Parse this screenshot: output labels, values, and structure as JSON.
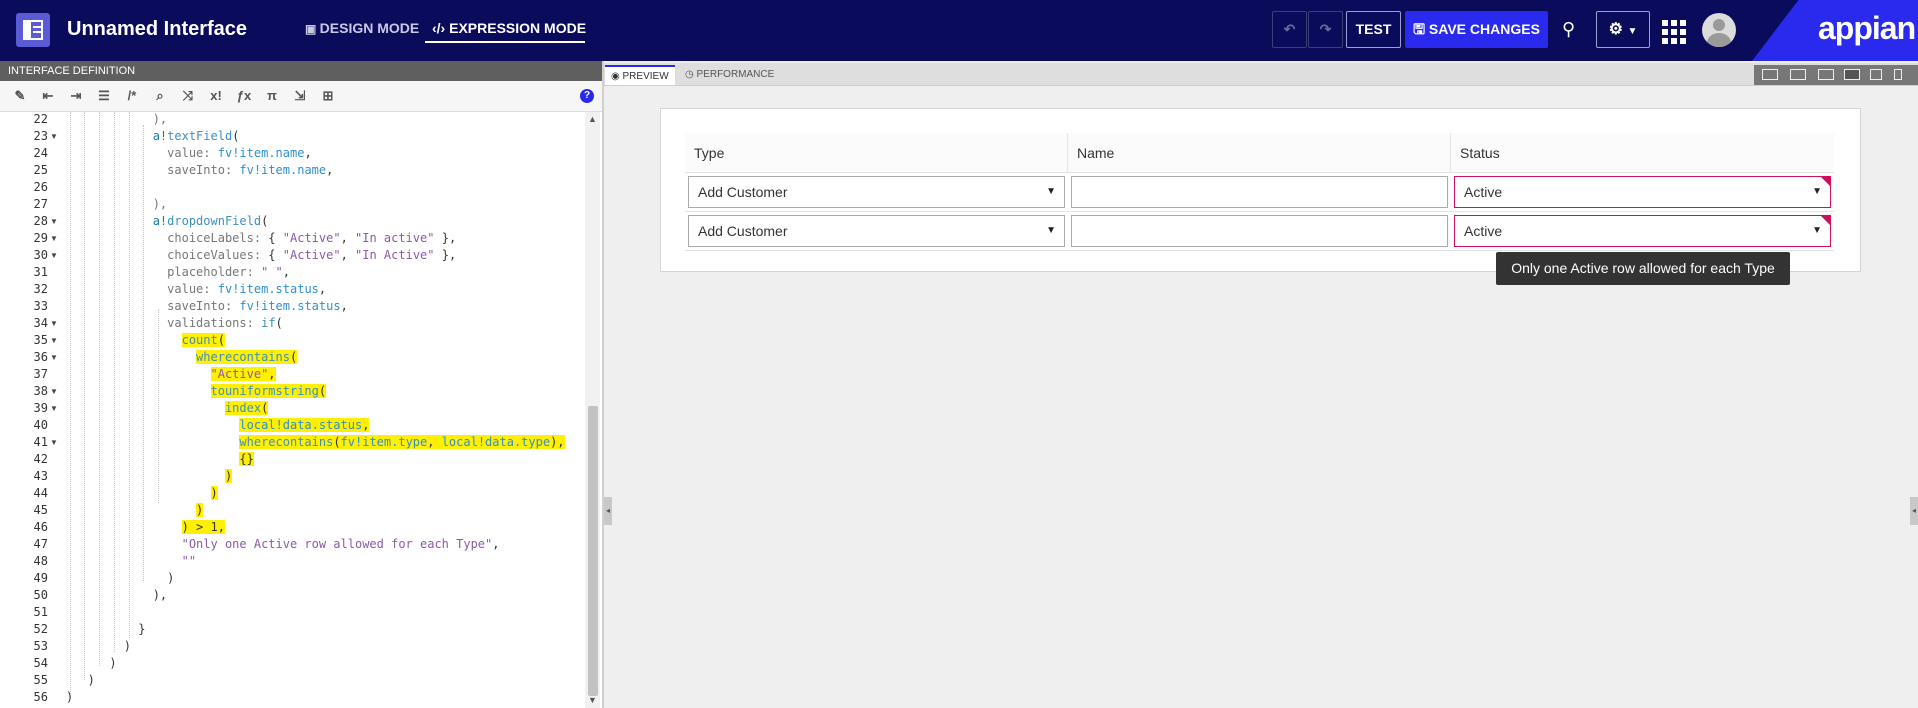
{
  "header": {
    "app_title": "Unnamed Interface",
    "design_mode": "DESIGN MODE",
    "expression_mode": "EXPRESSION MODE",
    "test": "TEST",
    "save_changes": "SAVE CHANGES",
    "brand": "appian"
  },
  "editor": {
    "panel_title": "INTERFACE DEFINITION",
    "help": "?",
    "line_numbers": [
      "22",
      "23",
      "24",
      "25",
      "26",
      "27",
      "28",
      "29",
      "30",
      "31",
      "32",
      "33",
      "34",
      "35",
      "36",
      "37",
      "38",
      "39",
      "40",
      "41",
      "42",
      "43",
      "44",
      "45",
      "46",
      "47",
      "48",
      "49",
      "50",
      "51",
      "52",
      "53",
      "54",
      "55",
      "56"
    ]
  },
  "preview": {
    "tabs": [
      "PREVIEW",
      "PERFORMANCE"
    ],
    "columns": [
      "Type",
      "Name",
      "Status"
    ],
    "rows": [
      {
        "type": "Add Customer",
        "name": "",
        "status": "Active"
      },
      {
        "type": "Add Customer",
        "name": "",
        "status": "Active"
      }
    ],
    "validation_message": "Only one Active row allowed for each Type"
  },
  "colors": {
    "topbar": "#0b0b5c",
    "accent": "#2a2aef",
    "error": "#d10e5a",
    "highlight": "#ffef00"
  }
}
